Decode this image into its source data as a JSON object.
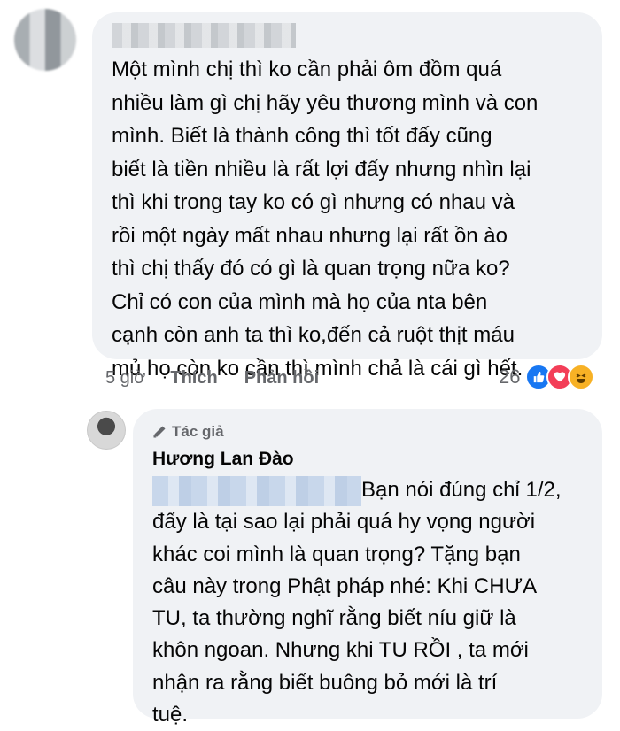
{
  "comment": {
    "text_lines": [
      "Một mình chị thì ko cần phải ôm đồm quá",
      "nhiều làm gì chị hãy yêu thương mình và con",
      "mình. Biết là thành công thì tốt đấy cũng",
      "biết là tiền nhiều là rất lợi đấy nhưng nhìn lại",
      "thì khi trong tay ko có gì nhưng có nhau và",
      "rồi một ngày mất nhau nhưng lại rất ồn ào",
      "thì chị thấy đó có gì là quan trọng nữa ko?",
      "Chỉ có con của mình mà họ của nta bên",
      "cạnh còn anh ta thì ko,đến cả ruột thịt máu",
      "mủ họ còn ko cần thì mình chả là cái gì hết."
    ],
    "time": "5 giờ",
    "like_label": "Thích",
    "reply_label": "Phản hồi",
    "reaction_count": "26",
    "reaction_icons": [
      "like-icon",
      "love-icon",
      "haha-icon"
    ]
  },
  "reply": {
    "badge": "Tác giả",
    "author_name": "Hương Lan Đào",
    "first_line_rest": "Bạn nói đúng chỉ 1/2,",
    "text_lines": [
      "đấy là tại sao lại phải quá hy vọng người",
      "khác coi mình là quan trọng? Tặng bạn",
      "câu này trong Phật pháp nhé: Khi CHƯA",
      "TU, ta thường nghĩ rằng biết níu giữ là",
      "khôn ngoan. Nhưng khi TU RỒI , ta mới",
      "nhận ra rằng biết buông bỏ mới là trí",
      "tuệ."
    ]
  },
  "colors": {
    "bubble": "#f0f2f5",
    "meta_text": "#65676b",
    "like_blue": "#1877f2",
    "love_red": "#f33e58",
    "haha_yellow": "#f7b125"
  }
}
